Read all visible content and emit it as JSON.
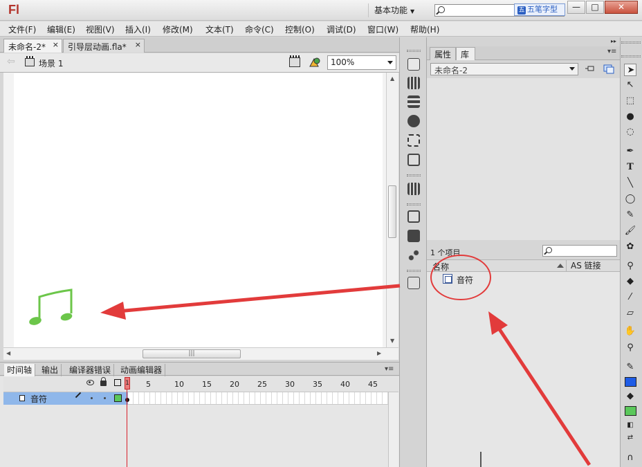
{
  "app": {
    "logo": "Fl",
    "workspace": "基本功能",
    "ime_badge": "五笔字型",
    "ime_mark": "五",
    "window_buttons": {
      "minimize": "—",
      "maximize": "□",
      "close": "✕"
    }
  },
  "menu": [
    "文件(F)",
    "编辑(E)",
    "视图(V)",
    "插入(I)",
    "修改(M)",
    "文本(T)",
    "命令(C)",
    "控制(O)",
    "调试(D)",
    "窗口(W)",
    "帮助(H)"
  ],
  "doc_tabs": [
    {
      "label": "未命名-2*",
      "close": "×"
    },
    {
      "label": "引导层动画.fla*",
      "close": "×"
    }
  ],
  "scene": {
    "label": "场景 1",
    "zoom": "100%"
  },
  "timeline": {
    "tabs": [
      "时间轴",
      "输出",
      "编译器错误",
      "动画编辑器"
    ],
    "frame_labels": [
      "5",
      "10",
      "15",
      "20",
      "25",
      "30",
      "35",
      "40",
      "45"
    ],
    "playhead": "1",
    "layer": {
      "name": "音符",
      "color": "#5bc85b"
    }
  },
  "library": {
    "tabs": [
      "属性",
      "库"
    ],
    "document": "未命名-2",
    "item_count": "1 个项目",
    "col_name": "名称",
    "col_linkage": "AS 链接",
    "items": [
      {
        "name": "音符"
      }
    ]
  },
  "colors": {
    "stroke": "#1e5ce6",
    "fill": "#5bc85b",
    "note": "#6cc64a",
    "annotation": "#e23b3b",
    "layer_highlight": "#8fb7ea"
  }
}
